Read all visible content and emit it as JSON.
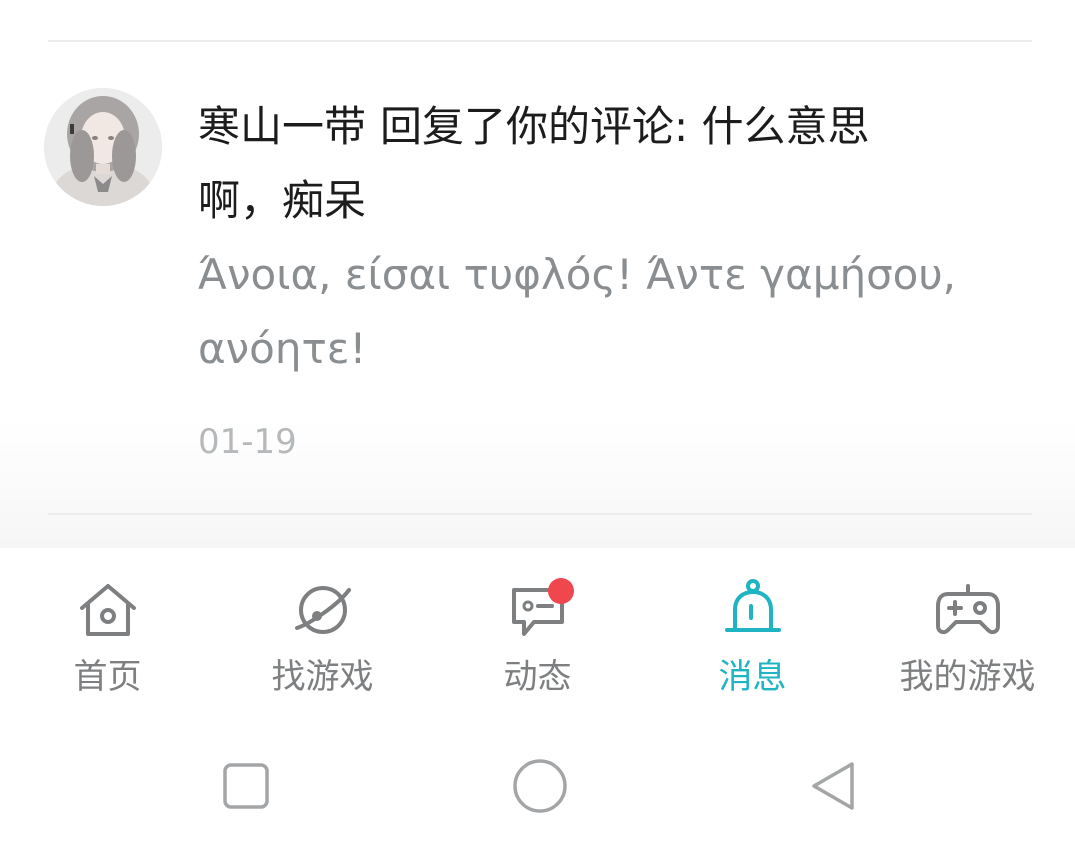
{
  "message": {
    "user_name": "寒山一带",
    "action_text": "回复了你的评论: 什么意思",
    "quoted_continuation": "啊，痴呆",
    "reply_text_line1": "Άνοια, είσαι τυφλός! Άντε γαμήσου,",
    "reply_text_line2": "ανόητε!",
    "timestamp": "01-19"
  },
  "tab_bar": {
    "active_color": "#1fb4c2",
    "inactive_color": "#7d7f81",
    "badge_color": "#f0474e",
    "tabs": [
      {
        "label": "首页",
        "icon": "home-icon",
        "active": false
      },
      {
        "label": "找游戏",
        "icon": "planet-icon",
        "active": false
      },
      {
        "label": "动态",
        "icon": "chat-bubble-icon",
        "active": false,
        "badge": true
      },
      {
        "label": "消息",
        "icon": "bell-icon",
        "active": true
      },
      {
        "label": "我的游戏",
        "icon": "gamepad-icon",
        "active": false
      }
    ]
  },
  "system_nav": {
    "buttons": [
      "recent-apps",
      "home",
      "back"
    ]
  }
}
